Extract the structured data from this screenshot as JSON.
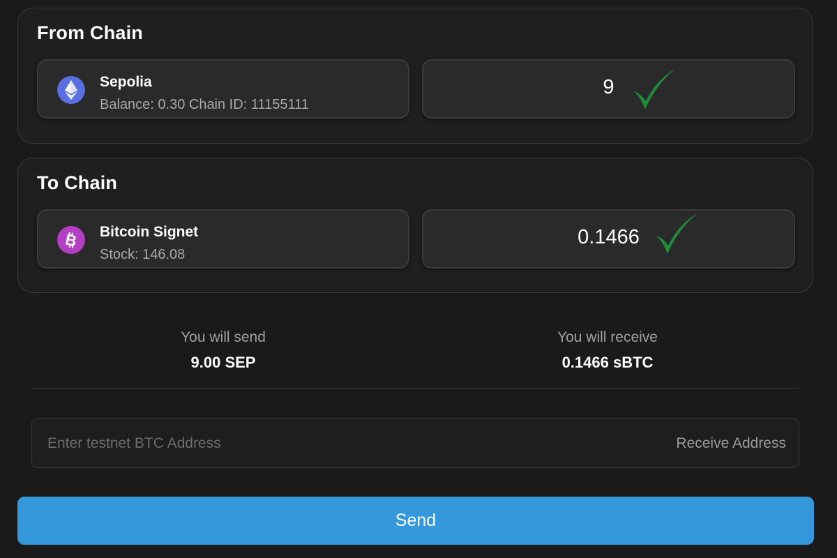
{
  "from_chain": {
    "title": "From Chain",
    "chain": {
      "name": "Sepolia",
      "details": "Balance: 0.30 Chain ID: 11155111",
      "icon": "ethereum-icon"
    },
    "amount": "9"
  },
  "to_chain": {
    "title": "To Chain",
    "chain": {
      "name": "Bitcoin Signet",
      "details": "Stock: 146.08",
      "icon": "bitcoin-icon"
    },
    "amount": "0.1466"
  },
  "summary": {
    "send_label": "You will send",
    "send_value": "9.00 SEP",
    "receive_label": "You will receive",
    "receive_value": "0.1466 sBTC"
  },
  "address": {
    "placeholder": "Enter testnet BTC Address",
    "value": "",
    "label": "Receive Address"
  },
  "send_button": {
    "label": "Send"
  },
  "colors": {
    "background": "#1a1a1a",
    "card": "#1f1f1f",
    "accent": "#3498db",
    "check": "#1e8c3a",
    "ethereum": "#5a6fe0",
    "bitcoin": "#b43fc4"
  },
  "annotations": {
    "check_icon": "check-icon"
  }
}
